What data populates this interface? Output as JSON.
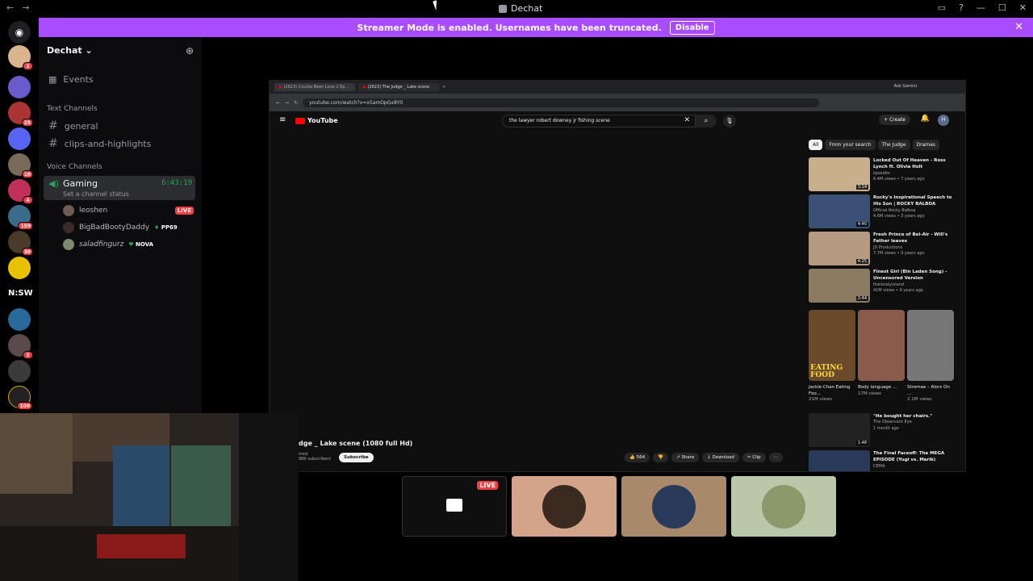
{
  "window": {
    "title": "Dechat",
    "back_icon": "←",
    "forward_icon": "→",
    "controls": [
      "inbox-icon",
      "help-icon",
      "minimize-icon",
      "maximize-icon",
      "close-icon"
    ]
  },
  "banner": {
    "text": "Streamer Mode is enabled. Usernames have been truncated.",
    "button": "Disable",
    "close": "✕",
    "color": "#a94bff"
  },
  "guilds": [
    {
      "badge": "2"
    },
    {
      "badge": ""
    },
    {
      "badge": "25"
    },
    {
      "badge": ""
    },
    {
      "badge": "10"
    },
    {
      "badge": "4"
    },
    {
      "badge": "159"
    },
    {
      "badge": "30"
    },
    {
      "badge": ""
    },
    {
      "label": "N:SW"
    },
    {
      "badge": ""
    },
    {
      "badge": "3"
    },
    {
      "badge": ""
    },
    {
      "badge": "100"
    }
  ],
  "sidebar": {
    "server_name": "Dechat",
    "chevron": "⌄",
    "events_label": "Events",
    "text_channels_label": "Text Channels",
    "voice_channels_label": "Voice Channels",
    "text_channels": [
      "general",
      "clips-and-highlights"
    ],
    "voice": {
      "name": "Gaming",
      "time": "6:43:19",
      "status": "Set a channel status",
      "users": [
        {
          "name": "leoshen",
          "live": "LIVE"
        },
        {
          "name": "BigBadBootyDaddy",
          "tag": "PP69"
        },
        {
          "name": "saladfingurz",
          "tag": "NOVA"
        }
      ]
    }
  },
  "stream": {
    "browser_tabs": [
      "(2623) Coulda Been Love 2 Ep...",
      "(2623) The Judge _ Lake scene"
    ],
    "ask_gemini": "Ask Gemini",
    "url": "youtube.com/watch?v=x5amOpGx8Y0",
    "yt_logo": "YouTube",
    "search_query": "the lawyer robert downey jr fishing scene",
    "create": "Create",
    "notif_count": "9+",
    "avatar": "H",
    "chips": [
      "All",
      "From your search",
      "The Judge",
      "Dramas"
    ],
    "recommendations": [
      {
        "title": "Locked Out Of Heaven - Ross Lynch ft. Olivia Holt",
        "channel": "lipsedits",
        "meta": "6.4M views • 7 years ago",
        "duration": "3:14",
        "color": "#c9b08d"
      },
      {
        "title": "Rocky's Inspirational Speech to His Son | ROCKY BALBOA",
        "channel": "Official Rocky Balboa",
        "meta": "4.6M views • 3 years ago",
        "duration": "4:40",
        "color": "#3a5074"
      },
      {
        "title": "Fresh Prince of Bel-Air - Will's Father leaves",
        "channel": "JD Productions",
        "meta": "7.7M views • 9 years ago",
        "duration": "4:25",
        "color": "#b49a80"
      },
      {
        "title": "Finest Girl (Bin Laden Song) - Uncensored Version",
        "channel": "thelonelyisland",
        "meta": "41M views • 9 years ago",
        "duration": "2:44",
        "color": "#8a7a62"
      }
    ],
    "shorts": [
      {
        "title": "Jackie Chan Eating Foo...",
        "views": "21M views",
        "caption": "EATING FOOD"
      },
      {
        "title": "Body language ...",
        "views": "17M views"
      },
      {
        "title": "Stromae – Alors On ...",
        "views": "2.1M views"
      }
    ],
    "rec_more": [
      {
        "title": "\"He bought her chairs.\"",
        "channel": "The Observant Eye",
        "meta": "1 month ago",
        "duration": "1:48"
      },
      {
        "title": "The Final Faceoff: The MEGA EPISODE (Yugi vs. Marik)",
        "channel": "CEMA",
        "meta": "",
        "duration": ""
      }
    ],
    "video_title": "dge _ Lake scene (1080 full Hd)",
    "channel_name": "med",
    "subscribers": "98K subscribers",
    "subscribe": "Subscribe",
    "likes": "564",
    "share": "Share",
    "download": "Download",
    "clip": "Clip"
  },
  "tiles": {
    "live": "LIVE"
  }
}
